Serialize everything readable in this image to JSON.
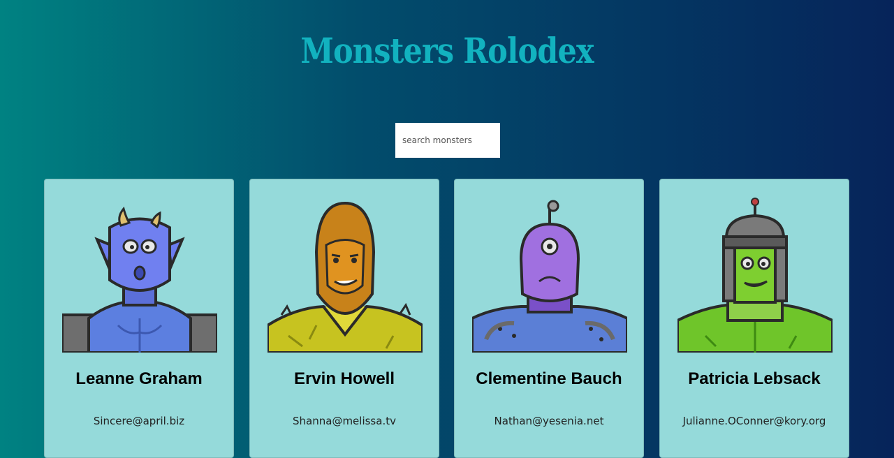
{
  "header": {
    "title": "Monsters Rolodex"
  },
  "search": {
    "placeholder": "search monsters",
    "value": ""
  },
  "monsters": [
    {
      "name": "Leanne Graham",
      "email": "Sincere@april.biz",
      "avatar": "blue-horned-monster"
    },
    {
      "name": "Ervin Howell",
      "email": "Shanna@melissa.tv",
      "avatar": "orange-hooded-monster"
    },
    {
      "name": "Clementine Bauch",
      "email": "Nathan@yesenia.net",
      "avatar": "purple-cyclops-robot"
    },
    {
      "name": "Patricia Lebsack",
      "email": "Julianne.OConner@kory.org",
      "avatar": "green-frankenstein-monster"
    }
  ]
}
